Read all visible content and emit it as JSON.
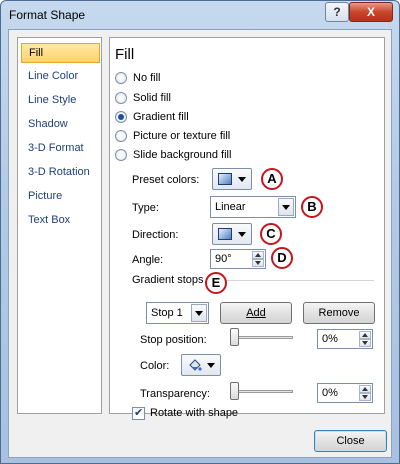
{
  "window": {
    "title": "Format Shape",
    "help_glyph": "?",
    "close_glyph": "X"
  },
  "nav": {
    "items": [
      {
        "label": "Fill",
        "selected": true
      },
      {
        "label": "Line Color",
        "selected": false
      },
      {
        "label": "Line Style",
        "selected": false
      },
      {
        "label": "Shadow",
        "selected": false
      },
      {
        "label": "3-D Format",
        "selected": false
      },
      {
        "label": "3-D Rotation",
        "selected": false
      },
      {
        "label": "Picture",
        "selected": false
      },
      {
        "label": "Text Box",
        "selected": false
      }
    ]
  },
  "fill": {
    "title": "Fill",
    "options": [
      {
        "label": "No fill",
        "checked": false
      },
      {
        "label": "Solid fill",
        "checked": false
      },
      {
        "label": "Gradient fill",
        "checked": true
      },
      {
        "label": "Picture or texture fill",
        "checked": false
      },
      {
        "label": "Slide background fill",
        "checked": false
      }
    ],
    "preset_colors_label": "Preset colors:",
    "type_label": "Type:",
    "type_value": "Linear",
    "direction_label": "Direction:",
    "angle_label": "Angle:",
    "angle_value": "90°",
    "gradient_stops_label": "Gradient stops",
    "stop_value": "Stop 1",
    "add_label": "Add",
    "remove_label": "Remove",
    "stop_position_label": "Stop position:",
    "stop_position_value": "0%",
    "color_label": "Color:",
    "transparency_label": "Transparency:",
    "transparency_value": "0%",
    "rotate_label": "Rotate with shape",
    "rotate_checked": true
  },
  "callouts": {
    "a": "A",
    "b": "B",
    "c": "C",
    "d": "D",
    "e": "E"
  },
  "footer": {
    "close_label": "Close"
  },
  "colors": {
    "callout_border": "#c4161c",
    "selection": "#ffd26b",
    "accent": "#1b4f9c"
  }
}
